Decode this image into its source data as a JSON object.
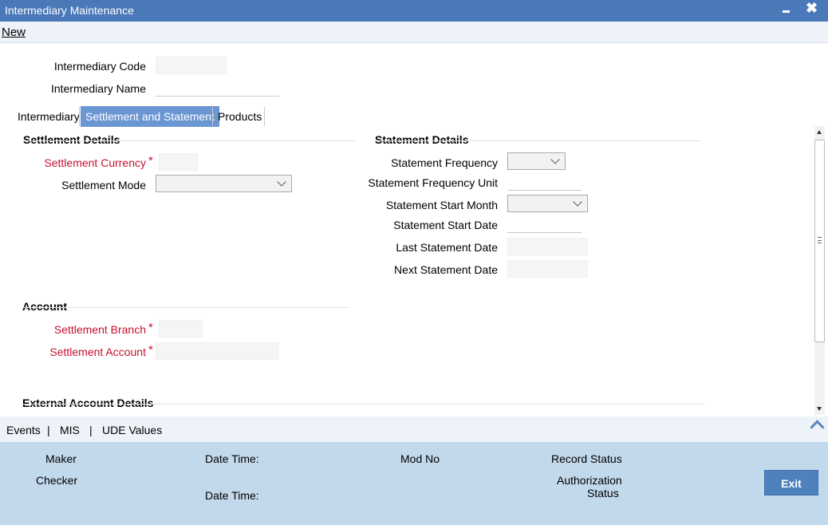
{
  "window": {
    "title": "Intermediary Maintenance",
    "minimize_icon": "minimize-icon",
    "close_glyph": "✖"
  },
  "menu": {
    "new_label": "New"
  },
  "header_fields": {
    "intermediary_code_label": "Intermediary Code",
    "intermediary_code_value": "",
    "intermediary_name_label": "Intermediary Name",
    "intermediary_name_value": ""
  },
  "tabs": [
    {
      "label": "Intermediary",
      "active": false
    },
    {
      "label": "Settlement and Statement",
      "active": true
    },
    {
      "label": "Products",
      "active": false
    }
  ],
  "settlement_details": {
    "title": "Settlement Details",
    "currency_label": "Settlement Currency",
    "currency_value": "",
    "mode_label": "Settlement Mode",
    "mode_value": ""
  },
  "statement_details": {
    "title": "Statement Details",
    "frequency_label": "Statement Frequency",
    "frequency_value": "",
    "frequency_unit_label": "Statement Frequency Unit",
    "frequency_unit_value": "",
    "start_month_label": "Statement Start Month",
    "start_month_value": "",
    "start_date_label": "Statement Start Date",
    "start_date_value": "",
    "last_date_label": "Last Statement Date",
    "last_date_value": "",
    "next_date_label": "Next Statement Date",
    "next_date_value": ""
  },
  "account": {
    "title": "Account",
    "branch_label": "Settlement Branch",
    "branch_value": "",
    "account_label": "Settlement Account",
    "account_value": ""
  },
  "external_account": {
    "title": "External Account Details"
  },
  "required_marker": "*",
  "bottom_links": [
    "Events",
    "|",
    "MIS",
    "|",
    "UDE Values"
  ],
  "audit": {
    "maker_label": "Maker",
    "checker_label": "Checker",
    "date_time_label_1": "Date Time:",
    "date_time_label_2": "Date Time:",
    "mod_no_label": "Mod No",
    "record_status_label": "Record Status",
    "auth_status_label_line1": "Authorization",
    "auth_status_label_line2": "Status"
  },
  "buttons": {
    "exit_label": "Exit"
  },
  "colors": {
    "title_bar": "#4a78b8",
    "active_tab": "#6a96d1",
    "required_label": "#c8102e",
    "footer_bg": "#c2d9ec",
    "exit_button": "#4f81bd"
  }
}
